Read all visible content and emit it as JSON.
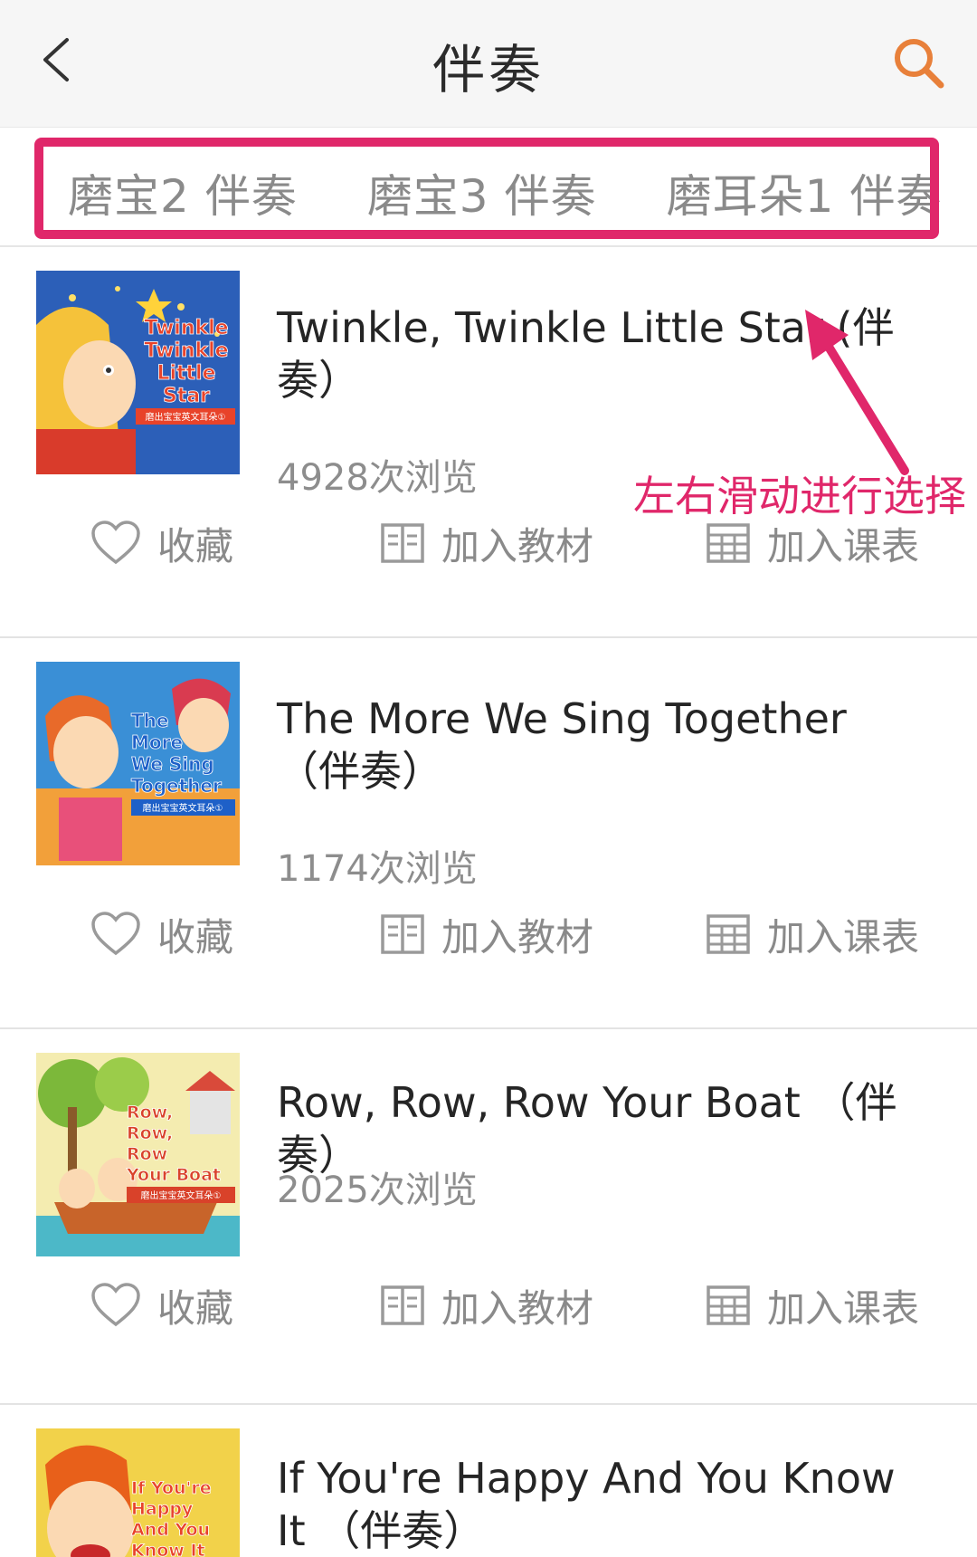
{
  "header": {
    "title": "伴奏"
  },
  "tabs": [
    {
      "label": "磨宝2 伴奏"
    },
    {
      "label": "磨宝3 伴奏"
    },
    {
      "label": "磨耳朵1 伴奏"
    }
  ],
  "annotation": {
    "text": "左右滑动进行选择",
    "color": "#e0276a"
  },
  "actions": {
    "favorite": "收藏",
    "add_textbook": "加入教材",
    "add_schedule": "加入课表"
  },
  "items": [
    {
      "title": "Twinkle, Twinkle Little Star (伴奏）",
      "views": "4928次浏览",
      "cover_lines": [
        "Twinkle",
        "Twinkle",
        "Little",
        "Star"
      ]
    },
    {
      "title": "The More We Sing Together （伴奏）",
      "views": "1174次浏览",
      "cover_lines": [
        "The",
        "More",
        "We Sing",
        "Together"
      ]
    },
    {
      "title": "Row, Row, Row Your Boat （伴奏）",
      "views": "2025次浏览",
      "cover_lines": [
        "Row,",
        "Row,",
        "Row",
        "Your Boat"
      ]
    },
    {
      "title": "If You're Happy And You Know It （伴奏）",
      "views": "",
      "cover_lines": [
        "If You're",
        "Happy",
        "And You",
        "Know It"
      ]
    }
  ],
  "cover_series_label": "磨出宝宝英文耳朵①",
  "colors": {
    "accent": "#e0276a",
    "search_icon": "#e8803a",
    "text_muted": "#8a8a8a"
  }
}
